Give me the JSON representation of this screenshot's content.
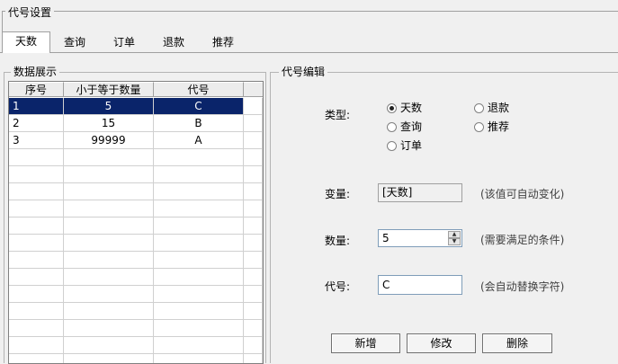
{
  "outer_title": "代号设置",
  "tabs": [
    "天数",
    "查询",
    "订单",
    "退款",
    "推荐"
  ],
  "data_panel": {
    "title": "数据展示",
    "columns": [
      "序号",
      "小于等于数量",
      "代号"
    ],
    "rows": [
      [
        "1",
        "5",
        "C"
      ],
      [
        "2",
        "15",
        "B"
      ],
      [
        "3",
        "99999",
        "A"
      ]
    ],
    "selected_row": 0
  },
  "edit_panel": {
    "title": "代号编辑",
    "type_label": "类型:",
    "type_options": [
      "天数",
      "退款",
      "查询",
      "推荐",
      "订单"
    ],
    "selected_type": "天数",
    "variable_label": "变量:",
    "variable_value": "[天数]",
    "variable_hint": "(该值可自动变化)",
    "quantity_label": "数量:",
    "quantity_value": "5",
    "quantity_hint": "(需要满足的条件)",
    "code_label": "代号:",
    "code_value": "C",
    "code_hint": "(会自动替换字符)",
    "buttons": {
      "add": "新增",
      "edit": "修改",
      "delete": "删除"
    }
  }
}
